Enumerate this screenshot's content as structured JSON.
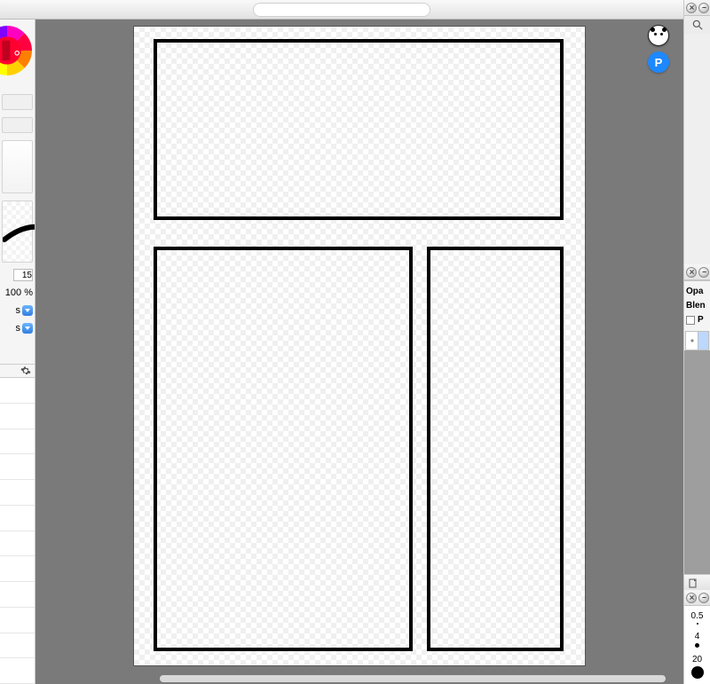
{
  "titlebar": {
    "filename": ""
  },
  "left": {
    "brush_size_value": "15",
    "opacity_value": "100 %",
    "dropdown_a_label": "s",
    "dropdown_b_label": "s"
  },
  "badges": {
    "panda_name": "account-avatar",
    "p_letter": "P"
  },
  "right": {
    "opacity_label": "Opa",
    "blend_label": "Blen",
    "preserve_label": "P",
    "brush_sizes": [
      {
        "label": "0.5",
        "px": 2
      },
      {
        "label": "4",
        "px": 5
      },
      {
        "label": "20",
        "px": 14
      }
    ]
  }
}
